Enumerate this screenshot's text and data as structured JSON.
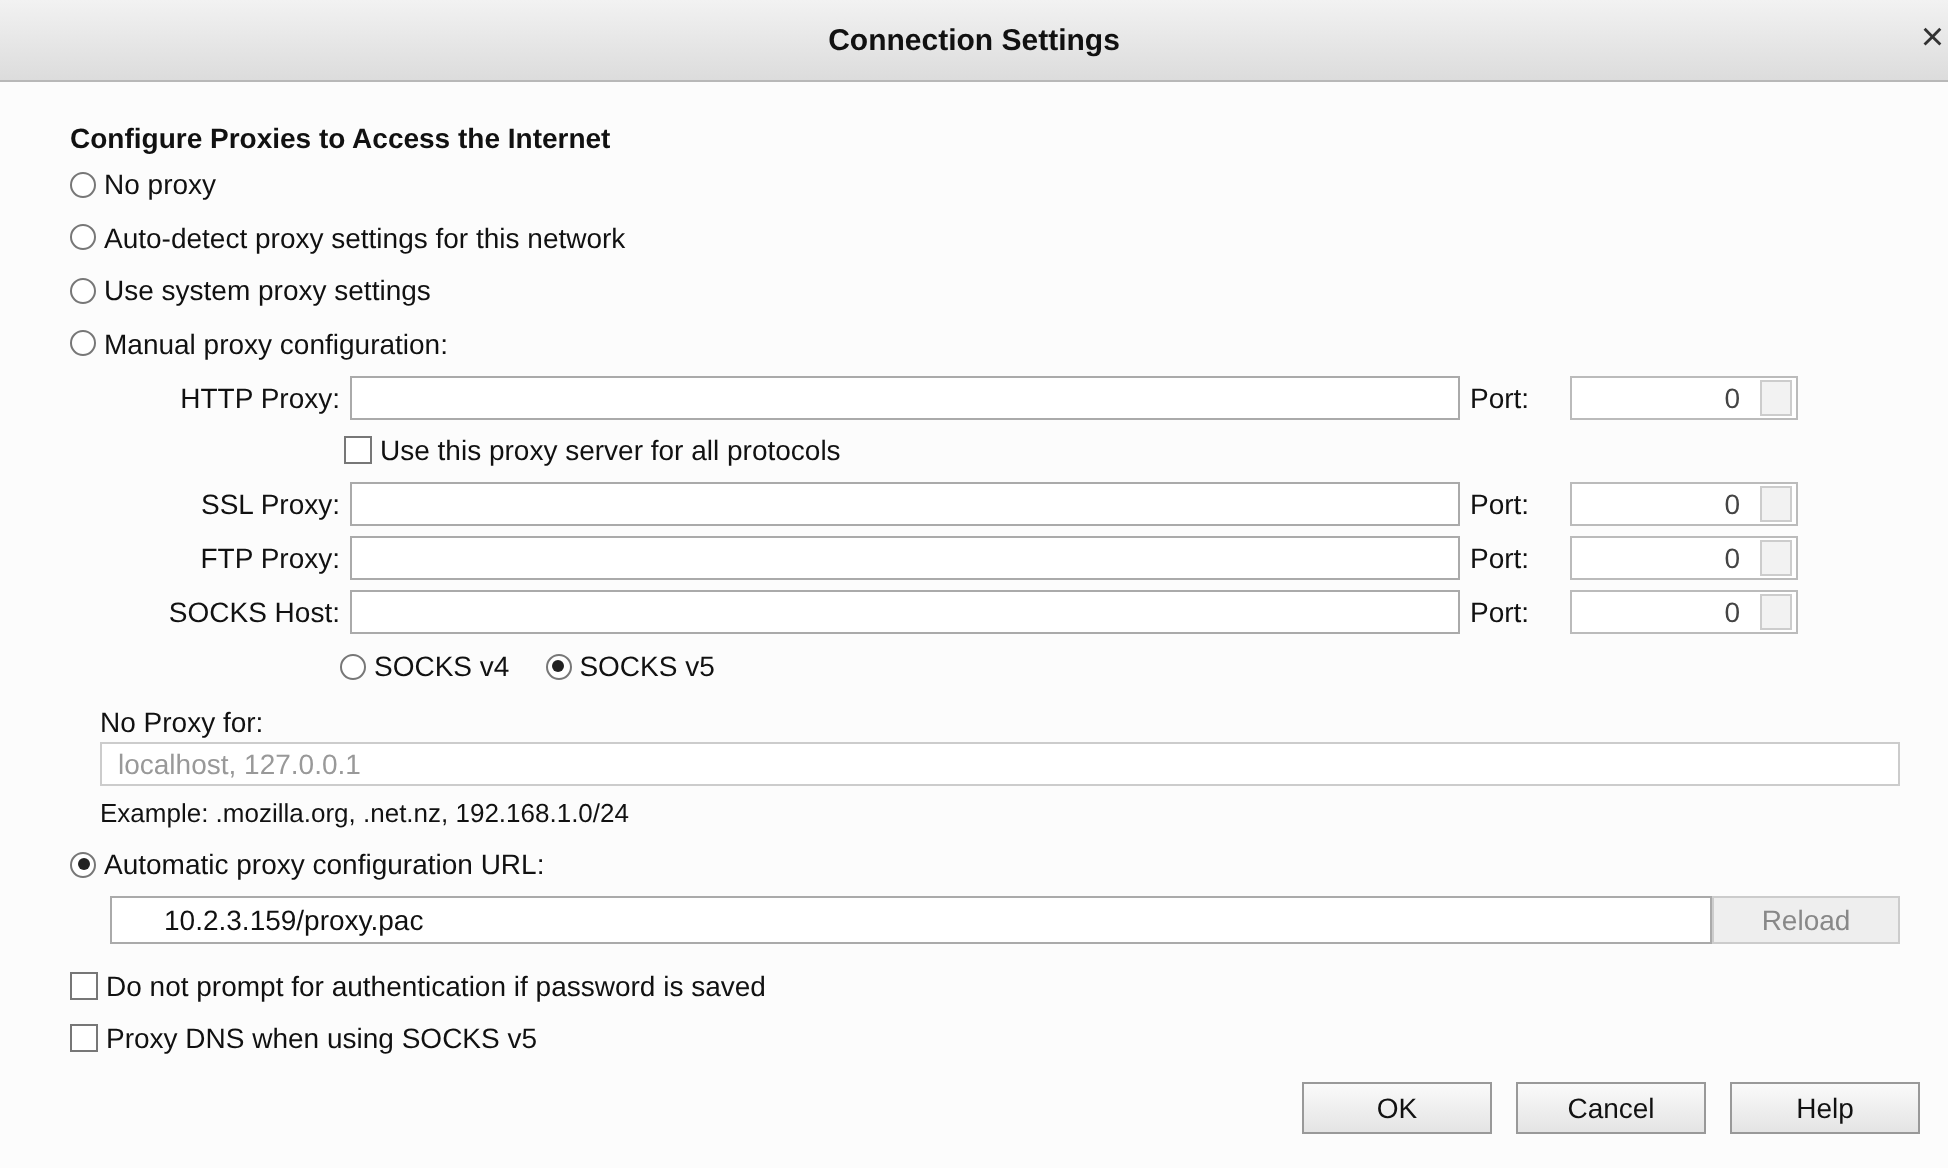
{
  "window": {
    "title": "Connection Settings",
    "close": "×"
  },
  "heading": "Configure Proxies to Access the Internet",
  "modes": [
    {
      "label": "No proxy",
      "selected": false
    },
    {
      "label": "Auto-detect proxy settings for this network",
      "selected": false
    },
    {
      "label": "Use system proxy settings",
      "selected": false
    },
    {
      "label": "Manual proxy configuration:",
      "selected": false
    }
  ],
  "manual": {
    "proxies": [
      {
        "label": "HTTP Proxy:",
        "port_label": "Port:",
        "port": "0"
      },
      {
        "label": "SSL Proxy:",
        "port_label": "Port:",
        "port": "0"
      },
      {
        "label": "FTP Proxy:",
        "port_label": "Port:",
        "port": "0"
      },
      {
        "label": "SOCKS Host:",
        "port_label": "Port:",
        "port": "0"
      }
    ],
    "share_all": {
      "label": "Use this proxy server for all protocols",
      "checked": false
    },
    "socks_versions": [
      {
        "label": "SOCKS v4",
        "selected": false
      },
      {
        "label": "SOCKS v5",
        "selected": true
      }
    ],
    "no_proxy": {
      "label": "No Proxy for:",
      "value": "localhost, 127.0.0.1",
      "disabled": true
    },
    "example": "Example: .mozilla.org, .net.nz, 192.168.1.0/24"
  },
  "auto": {
    "label": "Automatic proxy configuration URL:",
    "selected": true,
    "value": "10.2.3.159/proxy.pac",
    "reload": {
      "label": "Reload",
      "disabled": true
    }
  },
  "options": [
    {
      "label": "Do not prompt for authentication if password is saved",
      "checked": false
    },
    {
      "label": "Proxy DNS when using SOCKS v5",
      "checked": false
    }
  ],
  "buttons": [
    "OK",
    "Cancel",
    "Help"
  ]
}
